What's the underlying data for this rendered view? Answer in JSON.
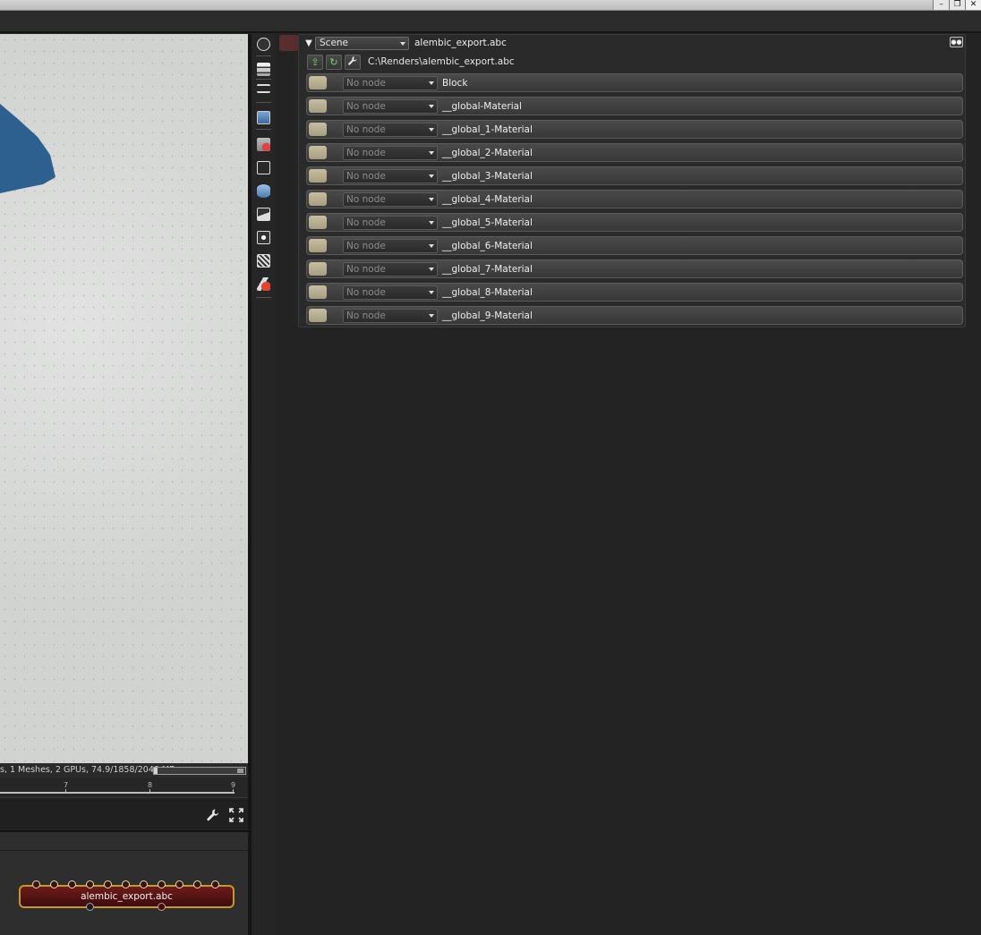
{
  "window": {
    "minimize": "–",
    "restore": "❐",
    "close": "✕"
  },
  "viewport": {
    "status_text": "s, 1 Meshes, 2 GPUs, 74.9/1858/2048 MB",
    "memory_fraction": 0.04,
    "timeline_ticks": [
      "7",
      "8",
      "9"
    ],
    "tools": {
      "settings_icon": "wrench-icon",
      "fullscreen_icon": "fullscreen-icon"
    }
  },
  "graph": {
    "node_label": "alembic_export.abc",
    "colors": {
      "node_border": "#c39a2a",
      "node_fill": "#5a1515"
    }
  },
  "toolbar_icons": [
    "camera-settings-icon",
    "render-layers-icon",
    "passes-icon",
    "image-icon",
    "camera-icon",
    "display-icon",
    "database-icon",
    "picture-icon",
    "light-icon",
    "texture-icon",
    "material-icon"
  ],
  "scene_panel": {
    "scene_select": "Scene",
    "scene_name": "alembic_export.abc",
    "file_path": "C:\\Renders\\alembic_export.abc",
    "buttons": {
      "load": "⇪",
      "reload": "↻",
      "settings": "🔧"
    },
    "combo_value": "No node",
    "materials": [
      "Block",
      "__global-Material",
      "__global_1-Material",
      "__global_2-Material",
      "__global_3-Material",
      "__global_4-Material",
      "__global_5-Material",
      "__global_6-Material",
      "__global_7-Material",
      "__global_8-Material",
      "__global_9-Material"
    ]
  }
}
